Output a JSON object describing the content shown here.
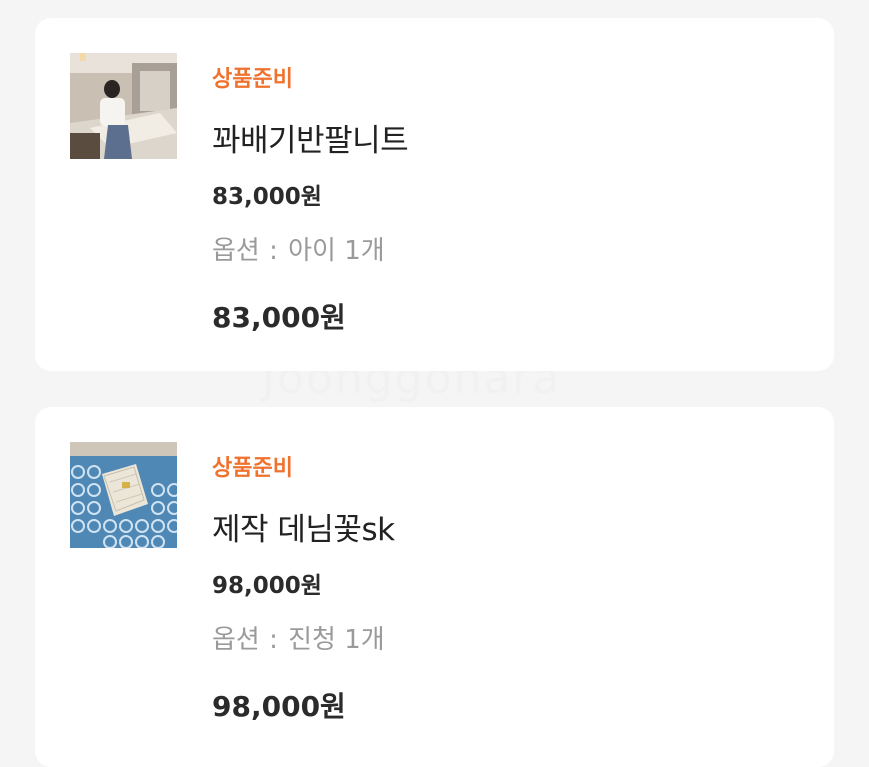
{
  "theme": {
    "status_color": "#f0722f",
    "background": "#f5f5f5",
    "card_background": "#ffffff"
  },
  "orders": [
    {
      "status": "상품준비",
      "name": "꽈배기반팔니트",
      "unit_price": "83,000원",
      "option_label": "옵션",
      "option_value": "아이 1개",
      "total_price": "83,000원",
      "thumbnail_icon": "product-photo-icon"
    },
    {
      "status": "상품준비",
      "name": "제작 데님꽃sk",
      "unit_price": "98,000원",
      "option_label": "옵션",
      "option_value": "진청 1개",
      "total_price": "98,000원",
      "thumbnail_icon": "product-photo-icon"
    }
  ],
  "separator": ":"
}
